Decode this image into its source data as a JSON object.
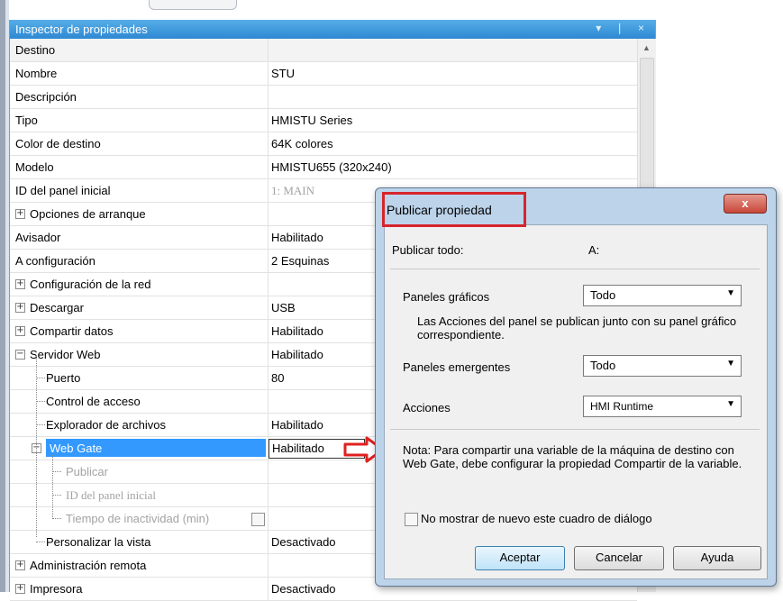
{
  "inspector": {
    "title": "Inspector de propiedades",
    "title_buttons": "▾ ❘ ×",
    "header": "Destino",
    "rows": [
      {
        "name": "Nombre",
        "value": "STU"
      },
      {
        "name": "Descripción",
        "value": ""
      },
      {
        "name": "Tipo",
        "value": "HMISTU Series"
      },
      {
        "name": "Color de destino",
        "value": "64K colores"
      },
      {
        "name": "Modelo",
        "value": "HMISTU655 (320x240)"
      },
      {
        "name": "ID del panel inicial",
        "value": "1: MAIN"
      },
      {
        "name": "Opciones  de arranque",
        "value": ""
      },
      {
        "name": "Avisador",
        "value": "Habilitado"
      },
      {
        "name": "A configuración",
        "value": "2 Esquinas"
      },
      {
        "name": "Configuración de la red",
        "value": ""
      },
      {
        "name": "Descargar",
        "value": "USB"
      },
      {
        "name": "Compartir datos",
        "value": "Habilitado"
      },
      {
        "name": "Servidor Web",
        "value": "Habilitado"
      },
      {
        "name": "Puerto",
        "value": "80"
      },
      {
        "name": "Control de acceso",
        "value": ""
      },
      {
        "name": "Explorador de archivos",
        "value": "Habilitado"
      },
      {
        "name": "Web Gate",
        "value": "Habilitado"
      },
      {
        "name": "Publicar",
        "value": ""
      },
      {
        "name": "ID del panel inicial",
        "value": ""
      },
      {
        "name": "Tiempo de inactividad (min)",
        "value": ""
      },
      {
        "name": "Personalizar la vista",
        "value": "Desactivado"
      },
      {
        "name": "Administración remota",
        "value": ""
      },
      {
        "name": "Impresora",
        "value": "Desactivado"
      }
    ]
  },
  "dialog": {
    "title": "Publicar propiedad",
    "close": "x",
    "publish_all_label": "Publicar todo:",
    "publish_all_value": "A:",
    "graphic_panels_label": "Paneles gráficos",
    "graphic_panels_value": "Todo",
    "note_actions": "Las Acciones del panel se publican junto con su panel gráfico correspondiente.",
    "popup_panels_label": "Paneles emergentes",
    "popup_panels_value": "Todo",
    "actions_label": "Acciones",
    "actions_value": "HMI Runtime",
    "note_webgate": "Nota: Para compartir una variable de la máquina de destino con Web Gate, debe configurar la propiedad Compartir de la variable.",
    "dont_show_label": "No mostrar de nuevo este cuadro de diálogo",
    "ok_label": "Aceptar",
    "cancel_label": "Cancelar",
    "help_label": "Ayuda"
  },
  "colors": {
    "title_bar": "#2e88d3",
    "selection": "#3399ff",
    "highlight_red": "#d6252c"
  }
}
